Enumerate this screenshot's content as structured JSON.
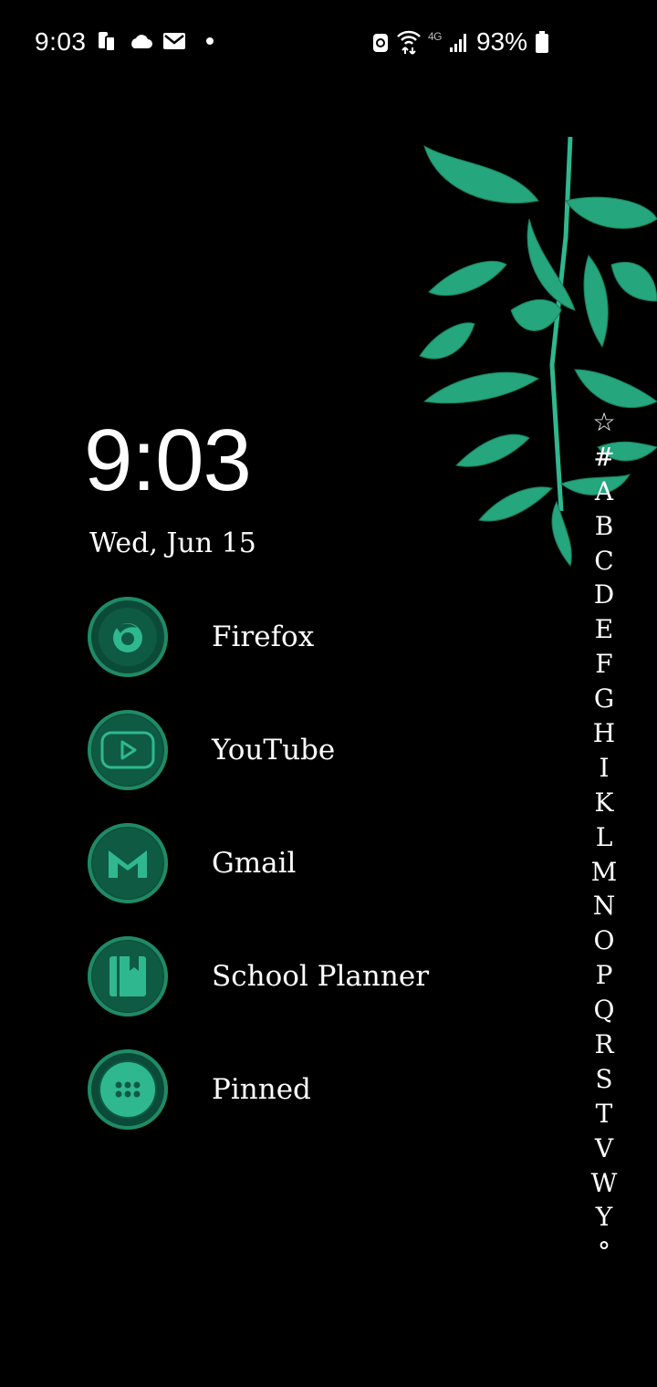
{
  "status_bar": {
    "time": "9:03",
    "network_label": "4G",
    "battery_percent": "93%"
  },
  "clock": {
    "time": "9:03",
    "date": "Wed, Jun 15"
  },
  "apps": [
    {
      "label": "Firefox",
      "icon": "firefox-icon"
    },
    {
      "label": "YouTube",
      "icon": "youtube-icon"
    },
    {
      "label": "Gmail",
      "icon": "gmail-icon"
    },
    {
      "label": "School Planner",
      "icon": "planner-icon"
    },
    {
      "label": "Pinned",
      "icon": "pinned-icon"
    }
  ],
  "index_letters": [
    "☆",
    "#",
    "A",
    "B",
    "C",
    "D",
    "E",
    "F",
    "G",
    "H",
    "I",
    "K",
    "L",
    "M",
    "N",
    "O",
    "P",
    "Q",
    "R",
    "S",
    "T",
    "V",
    "W",
    "Y",
    "°"
  ],
  "colors": {
    "accent": "#2fb890",
    "icon_bg": "#0c4a38",
    "leaf": "#25a67d"
  }
}
